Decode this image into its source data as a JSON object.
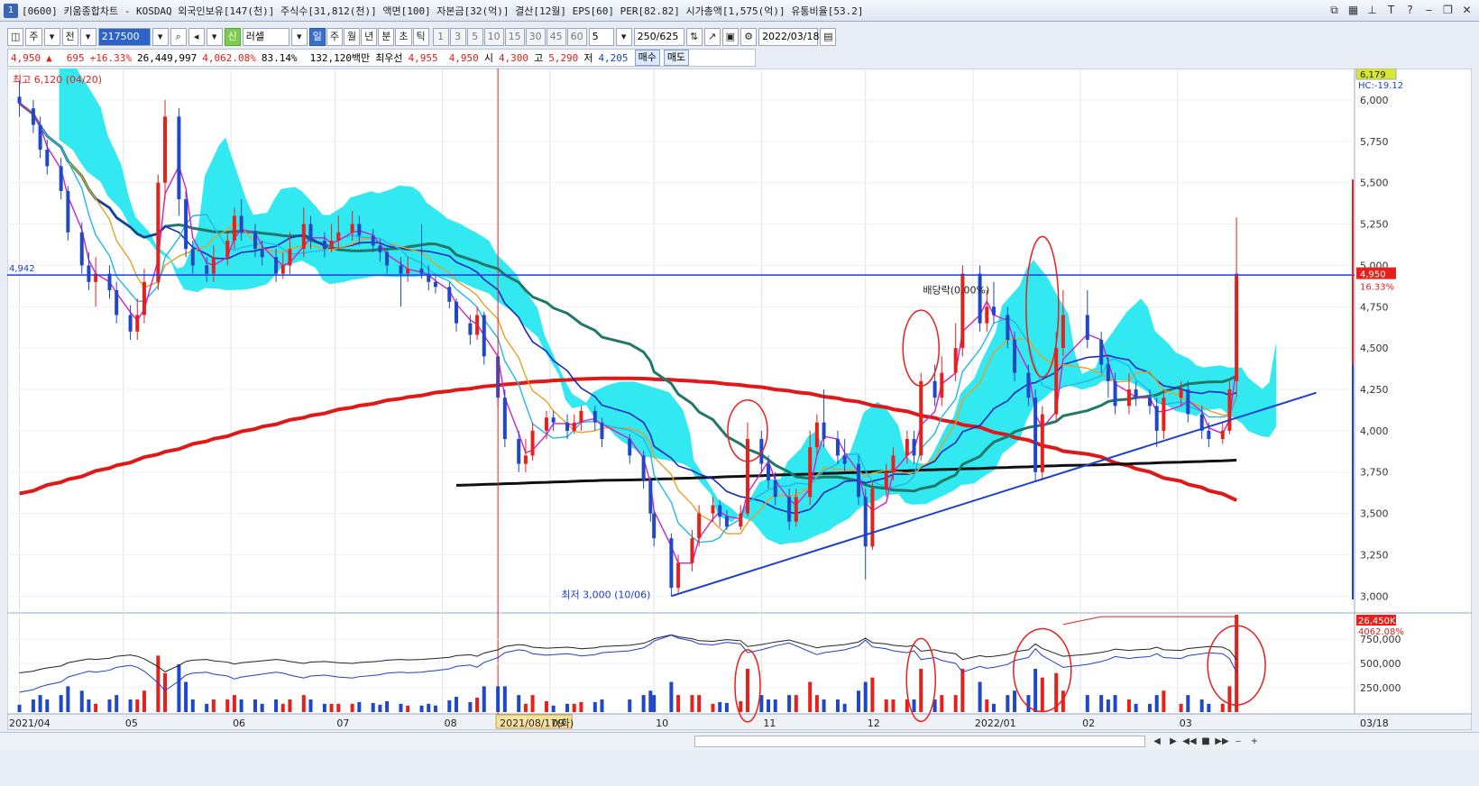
{
  "window": {
    "title": "[0600] 키움종합차트 - KOSDAQ 외국인보유[147(천)] 주식수[31,812(천)] 액면[100] 자본금[32(억)] 결산[12월] EPS[60] PER[82.82] 시가총액[1,575(억)] 유통비율[53.2]",
    "icon": "1"
  },
  "toolbar": {
    "mode1": "주",
    "mode2": "전",
    "code": "217500",
    "name": "러셀",
    "name_badge": "신",
    "periods": [
      "일",
      "주",
      "월",
      "년",
      "분",
      "초",
      "틱"
    ],
    "active_period": "일",
    "numbers": [
      "1",
      "3",
      "5",
      "10",
      "15",
      "30",
      "45",
      "60"
    ],
    "n_select": "5",
    "count": "250/625",
    "date": "2022/03/18"
  },
  "quote": {
    "price": "4,950",
    "arrow": "▲",
    "change": "695",
    "change_pct": "+16.33%",
    "volume": "26,449,997",
    "vol_ratio": "4,062.08%",
    "rate": "83.14%",
    "amount": "132,120백만",
    "label_best": "최우선",
    "best_ask": "4,955",
    "best_bid": "4,950",
    "label_open": "시",
    "open": "4,300",
    "label_high": "고",
    "high": "5,290",
    "label_low": "저",
    "low": "4,205",
    "buy": "매수",
    "sell": "매도"
  },
  "chart_data": {
    "type": "candlestick",
    "y_axis": {
      "min": 3000,
      "max": 6000,
      "ticks": [
        "6,000",
        "5,750",
        "5,500",
        "5,250",
        "5,000",
        "4,750",
        "4,500",
        "4,250",
        "4,000",
        "3,750",
        "3,500",
        "3,250",
        "3,000"
      ]
    },
    "volume_axis": {
      "ticks": [
        "750,000",
        "500,000",
        "250,000"
      ]
    },
    "x_labels": [
      "2021/04",
      "05",
      "06",
      "07",
      "08",
      "2021/08/17(화)",
      "09",
      "10",
      "11",
      "12",
      "2022/01",
      "02",
      "03",
      "03/18"
    ],
    "annotations": {
      "high": "최고 6,120 (04/20)",
      "low": "최저 3,000 (10/06)",
      "dividend": "배당락(0.00%)",
      "hline_value": "4,942",
      "top_right_price": "6,179",
      "hc_label": "HC:-19.12",
      "current_price": "4,950",
      "current_pct": "16.33%",
      "vol_current": "26,450K",
      "vol_pct": "4062.08%"
    },
    "colors": {
      "up": "#e8201c",
      "down": "#1f48c8",
      "cloud": "#28e8f0",
      "ma_pink": "#d020c8",
      "ma_orange": "#e8a020",
      "ma_sky": "#20b8e8",
      "ma_blue": "#1828c0",
      "ma_teal": "#207868",
      "ma_red": "#e01818",
      "ma_black": "#101010",
      "trendline": "#1d3fd0",
      "hline": "#1d3fd0"
    },
    "candles": [
      [
        "2021-04-01",
        6020,
        5980,
        6120,
        5900
      ],
      [
        "2021-04-05",
        5950,
        5850,
        6000,
        5800
      ],
      [
        "2021-04-07",
        5850,
        5700,
        5900,
        5650
      ],
      [
        "2021-04-09",
        5700,
        5600,
        5760,
        5550
      ],
      [
        "2021-04-13",
        5600,
        5450,
        5650,
        5400
      ],
      [
        "2021-04-15",
        5450,
        5200,
        5480,
        5150
      ],
      [
        "2021-04-19",
        5200,
        5000,
        5260,
        4950
      ],
      [
        "2021-04-21",
        5000,
        4900,
        5080,
        4850
      ],
      [
        "2021-04-23",
        4900,
        4950,
        5050,
        4750
      ],
      [
        "2021-04-27",
        4950,
        4850,
        5000,
        4800
      ],
      [
        "2021-04-29",
        4850,
        4700,
        4900,
        4650
      ],
      [
        "2021-05-03",
        4700,
        4600,
        4760,
        4550
      ],
      [
        "2021-05-05",
        4600,
        4700,
        4800,
        4550
      ],
      [
        "2021-05-07",
        4700,
        4900,
        4980,
        4650
      ],
      [
        "2021-05-11",
        4900,
        5500,
        5550,
        4850
      ],
      [
        "2021-05-13",
        5500,
        5900,
        6000,
        5400
      ],
      [
        "2021-05-17",
        5900,
        5400,
        5950,
        5300
      ],
      [
        "2021-05-19",
        5400,
        5100,
        5450,
        5050
      ],
      [
        "2021-05-21",
        5100,
        5000,
        5150,
        4950
      ],
      [
        "2021-05-25",
        5000,
        4950,
        5050,
        4900
      ],
      [
        "2021-05-27",
        4950,
        5050,
        5120,
        4900
      ],
      [
        "2021-05-31",
        5050,
        5150,
        5200,
        5000
      ],
      [
        "2021-06-02",
        5150,
        5300,
        5350,
        5100
      ],
      [
        "2021-06-04",
        5300,
        5200,
        5400,
        5150
      ],
      [
        "2021-06-08",
        5200,
        5100,
        5250,
        5050
      ],
      [
        "2021-06-10",
        5100,
        5050,
        5150,
        5000
      ],
      [
        "2021-06-14",
        5050,
        4950,
        5100,
        4900
      ],
      [
        "2021-06-16",
        4950,
        5000,
        5080,
        4920
      ],
      [
        "2021-06-18",
        5000,
        5100,
        5200,
        4950
      ],
      [
        "2021-06-22",
        5100,
        5250,
        5350,
        5050
      ],
      [
        "2021-06-24",
        5250,
        5150,
        5300,
        5100
      ],
      [
        "2021-06-28",
        5150,
        5100,
        5200,
        5050
      ],
      [
        "2021-06-30",
        5100,
        5150,
        5250,
        5080
      ],
      [
        "2021-07-02",
        5150,
        5200,
        5300,
        5100
      ],
      [
        "2021-07-06",
        5200,
        5250,
        5330,
        5150
      ],
      [
        "2021-07-08",
        5250,
        5180,
        5300,
        5120
      ],
      [
        "2021-07-12",
        5180,
        5120,
        5220,
        5080
      ],
      [
        "2021-07-14",
        5120,
        5080,
        5160,
        5020
      ],
      [
        "2021-07-16",
        5080,
        5000,
        5100,
        4950
      ],
      [
        "2021-07-20",
        5000,
        4950,
        5050,
        4750
      ],
      [
        "2021-07-22",
        4950,
        4980,
        5050,
        4900
      ],
      [
        "2021-07-26",
        4980,
        4950,
        5250,
        4920
      ],
      [
        "2021-07-28",
        4950,
        4900,
        5000,
        4850
      ],
      [
        "2021-07-30",
        4900,
        4870,
        4950,
        4830
      ],
      [
        "2021-08-03",
        4870,
        4780,
        4900,
        4740
      ],
      [
        "2021-08-05",
        4780,
        4650,
        4800,
        4600
      ],
      [
        "2021-08-09",
        4650,
        4580,
        4700,
        4520
      ],
      [
        "2021-08-11",
        4580,
        4700,
        4750,
        4550
      ],
      [
        "2021-08-13",
        4700,
        4450,
        4720,
        4400
      ],
      [
        "2021-08-17",
        4450,
        4200,
        4480,
        4150
      ],
      [
        "2021-08-19",
        4200,
        3950,
        4250,
        3900
      ],
      [
        "2021-08-23",
        3950,
        3800,
        4000,
        3750
      ],
      [
        "2021-08-25",
        3800,
        3850,
        3950,
        3750
      ],
      [
        "2021-08-27",
        3850,
        4000,
        4050,
        3820
      ],
      [
        "2021-08-31",
        4000,
        4080,
        4120,
        3950
      ],
      [
        "2021-09-02",
        4080,
        4050,
        4120,
        4000
      ],
      [
        "2021-09-06",
        4050,
        4000,
        4100,
        3950
      ],
      [
        "2021-09-08",
        4000,
        4050,
        4100,
        3980
      ],
      [
        "2021-09-10",
        4050,
        4120,
        4150,
        4000
      ],
      [
        "2021-09-14",
        4120,
        4050,
        4150,
        4000
      ],
      [
        "2021-09-16",
        4050,
        3950,
        4080,
        3900
      ],
      [
        "2021-09-24",
        3950,
        3850,
        3980,
        3800
      ],
      [
        "2021-09-28",
        3850,
        3700,
        3880,
        3650
      ],
      [
        "2021-09-30",
        3700,
        3500,
        3720,
        3450
      ],
      [
        "2021-10-01",
        3500,
        3350,
        3520,
        3300
      ],
      [
        "2021-10-06",
        3350,
        3050,
        3380,
        3000
      ],
      [
        "2021-10-08",
        3050,
        3200,
        3250,
        3020
      ],
      [
        "2021-10-12",
        3200,
        3350,
        3400,
        3150
      ],
      [
        "2021-10-14",
        3350,
        3500,
        3550,
        3300
      ],
      [
        "2021-10-18",
        3500,
        3550,
        3600,
        3450
      ],
      [
        "2021-10-20",
        3550,
        3480,
        3580,
        3420
      ],
      [
        "2021-10-22",
        3480,
        3420,
        3520,
        3400
      ],
      [
        "2021-10-26",
        3420,
        3500,
        3550,
        3400
      ],
      [
        "2021-10-28",
        3500,
        3950,
        4050,
        3480
      ],
      [
        "2021-11-01",
        3950,
        3800,
        4000,
        3750
      ],
      [
        "2021-11-03",
        3800,
        3700,
        3850,
        3650
      ],
      [
        "2021-11-05",
        3700,
        3600,
        3750,
        3550
      ],
      [
        "2021-11-09",
        3600,
        3450,
        3650,
        3400
      ],
      [
        "2021-11-11",
        3450,
        3600,
        3650,
        3420
      ],
      [
        "2021-11-15",
        3600,
        3900,
        4000,
        3550
      ],
      [
        "2021-11-17",
        3900,
        4050,
        4100,
        3850
      ],
      [
        "2021-11-19",
        4050,
        3950,
        4250,
        3900
      ],
      [
        "2021-11-23",
        3950,
        3850,
        4000,
        3800
      ],
      [
        "2021-11-25",
        3850,
        3800,
        3950,
        3750
      ],
      [
        "2021-11-29",
        3800,
        3600,
        3850,
        3550
      ],
      [
        "2021-12-01",
        3600,
        3300,
        3650,
        3100
      ],
      [
        "2021-12-03",
        3300,
        3650,
        3700,
        3280
      ],
      [
        "2021-12-07",
        3650,
        3750,
        3800,
        3600
      ],
      [
        "2021-12-09",
        3750,
        3850,
        3900,
        3700
      ],
      [
        "2021-12-13",
        3850,
        3950,
        4000,
        3800
      ],
      [
        "2021-12-15",
        3950,
        3850,
        4000,
        3800
      ],
      [
        "2021-12-17",
        3850,
        4300,
        4350,
        3820
      ],
      [
        "2021-12-21",
        4300,
        4200,
        4400,
        4150
      ],
      [
        "2021-12-23",
        4200,
        4350,
        4450,
        4150
      ],
      [
        "2021-12-27",
        4350,
        4500,
        4650,
        4300
      ],
      [
        "2021-12-29",
        4500,
        4950,
        5000,
        4450
      ],
      [
        "2022-01-03",
        4950,
        4650,
        5000,
        4600
      ],
      [
        "2022-01-05",
        4650,
        4750,
        4850,
        4600
      ],
      [
        "2022-01-07",
        4750,
        4700,
        4900,
        4650
      ],
      [
        "2022-01-11",
        4700,
        4550,
        4750,
        4500
      ],
      [
        "2022-01-13",
        4550,
        4350,
        4600,
        4300
      ],
      [
        "2022-01-17",
        4350,
        4200,
        4400,
        4150
      ],
      [
        "2022-01-19",
        4200,
        3750,
        4250,
        3700
      ],
      [
        "2022-01-21",
        3750,
        4100,
        4150,
        3700
      ],
      [
        "2022-01-25",
        4100,
        4500,
        4600,
        4050
      ],
      [
        "2022-01-27",
        4500,
        4700,
        4850,
        4450
      ],
      [
        "2022-02-03",
        4700,
        4550,
        4850,
        4500
      ],
      [
        "2022-02-07",
        4550,
        4400,
        4600,
        4350
      ],
      [
        "2022-02-09",
        4400,
        4300,
        4450,
        4200
      ],
      [
        "2022-02-11",
        4300,
        4150,
        4350,
        4100
      ],
      [
        "2022-02-15",
        4150,
        4250,
        4350,
        4100
      ],
      [
        "2022-02-17",
        4250,
        4200,
        4300,
        4150
      ],
      [
        "2022-02-21",
        4200,
        4150,
        4250,
        4100
      ],
      [
        "2022-02-23",
        4150,
        4000,
        4200,
        3900
      ],
      [
        "2022-02-25",
        4000,
        4200,
        4250,
        3950
      ],
      [
        "2022-03-02",
        4200,
        4250,
        4300,
        4150
      ],
      [
        "2022-03-04",
        4250,
        4100,
        4300,
        4050
      ],
      [
        "2022-03-08",
        4100,
        4000,
        4150,
        3950
      ],
      [
        "2022-03-10",
        4000,
        3950,
        4050,
        3900
      ],
      [
        "2022-03-14",
        3950,
        4000,
        4050,
        3920
      ],
      [
        "2022-03-16",
        4000,
        4250,
        4300,
        3980
      ],
      [
        "2022-03-18",
        4300,
        4950,
        5290,
        4205
      ]
    ]
  },
  "scrollbar": {
    "controls": [
      "◀",
      "▶",
      "◀◀",
      "■",
      "▶▶",
      "‒",
      "+"
    ]
  }
}
